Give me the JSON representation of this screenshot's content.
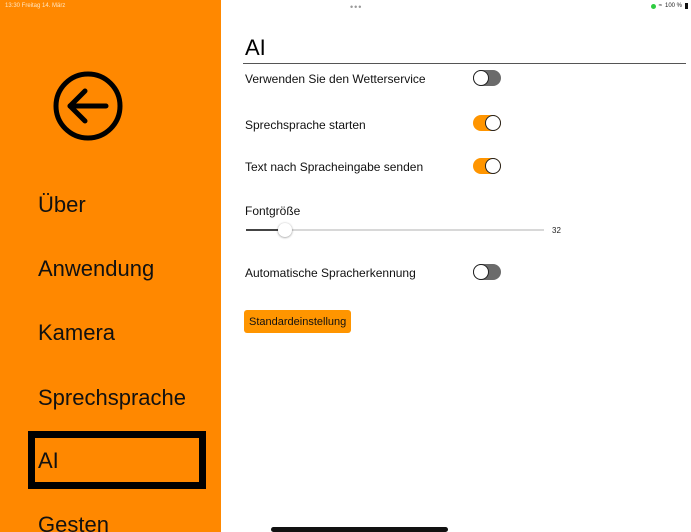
{
  "status_bar": {
    "time_date": "13:30  Freitag 14. März",
    "dots": "•••",
    "battery": "100 %"
  },
  "sidebar": {
    "back_icon": "arrow-left-circle-icon",
    "items": [
      {
        "label": "Über"
      },
      {
        "label": "Anwendung"
      },
      {
        "label": "Kamera"
      },
      {
        "label": "Sprechsprache"
      },
      {
        "label": "AI",
        "active": true
      },
      {
        "label": "Gesten"
      }
    ],
    "colors": {
      "background": "#ff8800",
      "active_border": "#000000"
    }
  },
  "main": {
    "title": "AI",
    "settings": [
      {
        "label": "Verwenden Sie den Wetterservice",
        "on": false
      },
      {
        "label": "Sprechsprache starten",
        "on": true
      },
      {
        "label": "Text nach Spracheingabe senden",
        "on": true
      }
    ],
    "font_size": {
      "label": "Fontgröße",
      "value": "32",
      "fraction": 0.13
    },
    "auto_detect": {
      "label": "Automatische Spracherkennung",
      "on": false
    },
    "reset_button": "Standardeinstellung",
    "colors": {
      "accent": "#ff9500",
      "toggle_off": "#6b6b6b"
    }
  }
}
